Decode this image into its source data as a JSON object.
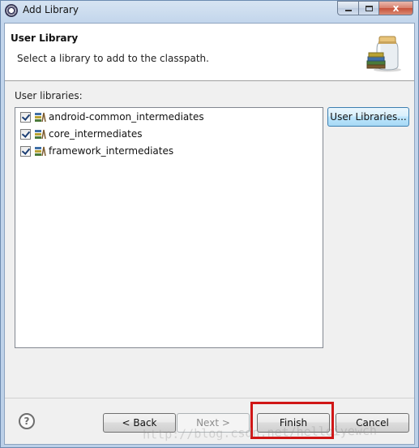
{
  "window": {
    "title": "Add Library",
    "close_glyph": "x"
  },
  "banner": {
    "title": "User Library",
    "description": "Select a library to add to the classpath."
  },
  "list": {
    "label": "User libraries:",
    "items": [
      {
        "label": "android-common_intermediates",
        "checked": true
      },
      {
        "label": "core_intermediates",
        "checked": true
      },
      {
        "label": "framework_intermediates",
        "checked": true
      }
    ]
  },
  "buttons": {
    "user_libraries": "User Libraries...",
    "back": "< Back",
    "next": "Next >",
    "finish": "Finish",
    "cancel": "Cancel",
    "help": "?"
  },
  "watermark": "http://blog.csdn.net/helloiyewch",
  "colors": {
    "highlight": "#d01616",
    "titlebar": "#c3d6ec",
    "dialog_bg": "#f0f0f0"
  },
  "icons": {
    "app": "eclipse-icon",
    "wizard": "library-jar-icon",
    "library": "library-icon",
    "help": "help-icon"
  }
}
